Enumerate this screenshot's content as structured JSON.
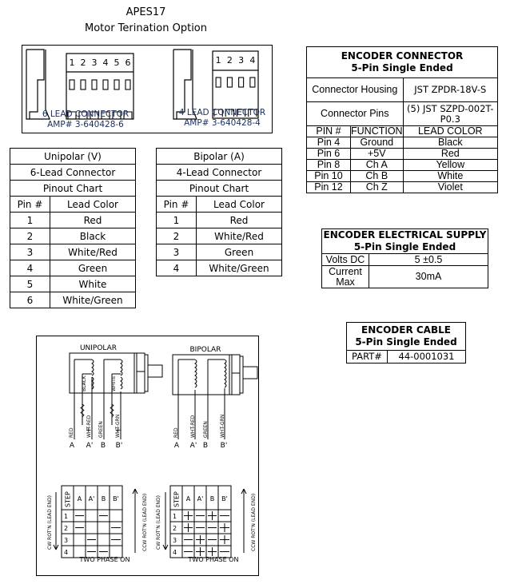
{
  "header": {
    "model": "APES17",
    "subtitle": "Motor Terination Option"
  },
  "connectors": {
    "six_lead": {
      "pins": [
        "1",
        "2",
        "3",
        "4",
        "5",
        "6"
      ],
      "label": "6 LEAD CONNECTOR",
      "part": "AMP# 3-640428-6"
    },
    "four_lead": {
      "pins": [
        "1",
        "2",
        "3",
        "4"
      ],
      "label": "4 LEAD CONNECTOR",
      "part": "AMP# 3-640428-4"
    },
    "label_color": "#1a2d5a"
  },
  "unipolar_table": {
    "title": "Unipolar (V)",
    "subtitle": "6-Lead Connector",
    "caption": "Pinout Chart",
    "headers": [
      "Pin #",
      "Lead Color"
    ],
    "rows": [
      [
        "1",
        "Red"
      ],
      [
        "2",
        "Black"
      ],
      [
        "3",
        "White/Red"
      ],
      [
        "4",
        "Green"
      ],
      [
        "5",
        "White"
      ],
      [
        "6",
        "White/Green"
      ]
    ]
  },
  "bipolar_table": {
    "title": "Bipolar (A)",
    "subtitle": "4-Lead Connector",
    "caption": "Pinout Chart",
    "headers": [
      "Pin #",
      "Lead Color"
    ],
    "rows": [
      [
        "1",
        "Red"
      ],
      [
        "2",
        "White/Red"
      ],
      [
        "3",
        "Green"
      ],
      [
        "4",
        "White/Green"
      ]
    ]
  },
  "encoder_connector": {
    "title": "ENCODER CONNECTOR",
    "subtitle": "5-Pin Single Ended",
    "housing_label": "Connector Housing",
    "housing_value": "JST ZPDR-18V-S",
    "pins_label": "Connector Pins",
    "pins_value": "(5) JST SZPD-002T-P0.3",
    "headers": [
      "PIN #",
      "FUNCTION",
      "LEAD COLOR"
    ],
    "rows": [
      [
        "Pin 4",
        "Ground",
        "Black"
      ],
      [
        "Pin 6",
        "+5V",
        "Red"
      ],
      [
        "Pin 8",
        "Ch A",
        "Yellow"
      ],
      [
        "Pin 10",
        "Ch B",
        "White"
      ],
      [
        "Pin 12",
        "Ch Z",
        "Violet"
      ]
    ]
  },
  "encoder_supply": {
    "title": "ENCODER ELECTRICAL SUPPLY",
    "subtitle": "5-Pin Single Ended",
    "rows": [
      [
        "Volts DC",
        "5 ±0.5"
      ],
      [
        "Current Max",
        "30mA"
      ]
    ]
  },
  "encoder_cable": {
    "title": "ENCODER CABLE",
    "subtitle": "5-Pin Single Ended",
    "part_label": "PART#",
    "part_value": "44-0001031"
  },
  "wiring": {
    "unipolar": {
      "title": "UNIPOLAR",
      "tap_labels": [
        "BLACK",
        "WHITE"
      ],
      "lead_labels": [
        "RED",
        "WHT-RED",
        "GREEN",
        "WHT-GRN"
      ],
      "terminals": [
        "A",
        "A'",
        "B",
        "B'"
      ],
      "step_header": [
        "STEP",
        "A",
        "A'",
        "B",
        "B'"
      ],
      "steps": [
        [
          "1",
          "-",
          "",
          "-",
          ""
        ],
        [
          "2",
          "-",
          "",
          "",
          "-"
        ],
        [
          "3",
          "",
          "-",
          "",
          "-"
        ],
        [
          "4",
          "",
          "-",
          "-",
          ""
        ]
      ],
      "cw_label": "CW ROT'N (LEAD END)",
      "ccw_label": "CCW ROT'N (LEAD END)",
      "caption": "TWO PHASE ON"
    },
    "bipolar": {
      "title": "BIPOLAR",
      "lead_labels": [
        "RED",
        "WHT-RED",
        "GREEN",
        "WHT-GRN"
      ],
      "terminals": [
        "A",
        "A'",
        "B",
        "B'"
      ],
      "step_header": [
        "STEP",
        "A",
        "A'",
        "B",
        "B'"
      ],
      "steps": [
        [
          "1",
          "+",
          "-",
          "+",
          "-"
        ],
        [
          "2",
          "+",
          "-",
          "-",
          "+"
        ],
        [
          "3",
          "-",
          "+",
          "-",
          "+"
        ],
        [
          "4",
          "-",
          "+",
          "+",
          "-"
        ]
      ],
      "cw_label": "CW ROT'N (LEAD END)",
      "ccw_label": "CCW ROT'N (LEAD END)",
      "caption": "TWO PHASE ON"
    }
  }
}
